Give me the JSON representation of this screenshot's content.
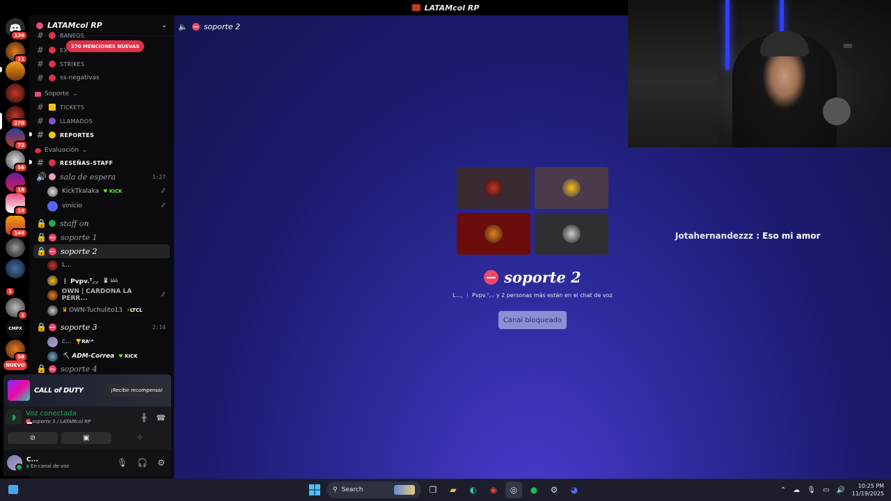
{
  "window": {
    "title": "LATAMcol RP"
  },
  "rail": {
    "badges": [
      "136",
      "11",
      "270",
      "72",
      "56",
      "18",
      "19",
      "144",
      "1",
      "1",
      "58"
    ],
    "nuevo_label": "NUEVO"
  },
  "guild": {
    "name": "LATAMcol RP",
    "mentions_label": "270 MENCIONES NUEVAS"
  },
  "channels": {
    "baneos": "BANEOS",
    "ex": "EX",
    "strikes": "STRIKES",
    "ss_negativas": "ss-negativas",
    "cat_soporte": "Soporte",
    "tickets": "TICKETS",
    "llamados": "LLAMADOS",
    "reportes": "REPORTES",
    "cat_evaluacion": "Evaluación",
    "resenas_staff": "RESEÑAS-STAFF",
    "sala_espera": "sala de espera",
    "sala_espera_time": "1:27",
    "staff_on": "staff on",
    "soporte1": "soporte 1",
    "soporte2": "soporte 2",
    "soporte3": "soporte 3",
    "soporte3_time": "2:14",
    "soporte4": "soporte 4"
  },
  "voice_users": {
    "sala": [
      {
        "name": "KickTkalaka",
        "tag": "KICK"
      },
      {
        "name": "vinicio",
        "tag": ""
      }
    ],
    "soporte2": [
      {
        "name": "L...",
        "tag": ""
      },
      {
        "name": "⋮ Pvpv.ᵀ⸝⸝",
        "tag": ""
      },
      {
        "name": "OWN | CARDONA LA PERR...",
        "tag": ""
      },
      {
        "name": "OWN-Tuchulito13",
        "tag": "LTCL"
      }
    ],
    "soporte3": [
      {
        "name": "c...",
        "tag": "RAᴸᴬ"
      },
      {
        "name": "ADM-Correa",
        "tag": "KICK"
      }
    ]
  },
  "promo": {
    "game": "CALL of DUTY",
    "reward": "¡Recibir recompensa!"
  },
  "voice_panel": {
    "status": "Voz conectada",
    "location": "soporte 3 / LATAMcol RP"
  },
  "userbar": {
    "name": "C...",
    "status": "En canal de voz"
  },
  "stage": {
    "header": "soporte 2",
    "title": "soporte 2",
    "subtitle": "L..., ⋮ Pvpv.ᵀ⸝⸝ y 2 personas más están en el chat de voz",
    "locked_button": "Canal bloqueado"
  },
  "chat_overlay": {
    "user": "Jotahernandezzz",
    "message": " : Eso mi amor"
  },
  "taskbar": {
    "search_placeholder": "Search",
    "time": "10:25 PM",
    "date": "11/19/2025"
  }
}
